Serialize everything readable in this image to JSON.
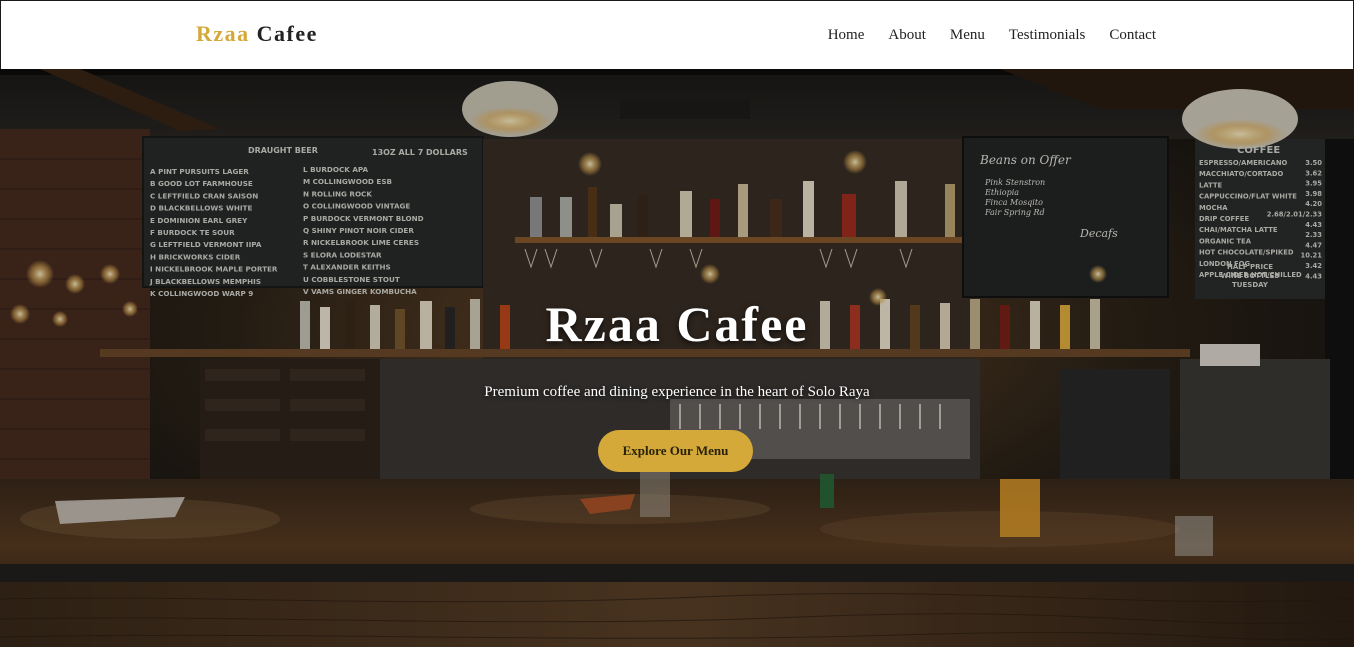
{
  "brand": {
    "name_accent": "Rzaa",
    "name_rest": "Cafee",
    "accent_color": "#d4a93a"
  },
  "nav": {
    "items": [
      "Home",
      "About",
      "Menu",
      "Testimonials",
      "Contact"
    ]
  },
  "hero": {
    "title": "Rzaa Cafee",
    "subtitle": "Premium coffee and dining experience in the heart of Solo Raya",
    "cta_label": "Explore Our Menu",
    "background": "photo of a dimly lit bar with bottle shelves and chalkboard menus"
  },
  "boards": {
    "left_heading": "DRAUGHT BEER",
    "left_sizes": "13OZ   ALL 7 DOLLARS",
    "left_col1": [
      "A PINT PURSUITS LAGER",
      "B GOOD LOT  FARMHOUSE",
      "C LEFTFIELD CRAN SAISON",
      "D BLACKBELLOWS WHITE",
      "E DOMINION EARL GREY",
      "F BURDOCK TE  SOUR",
      "G LEFTFIELD VERMONT IIPA",
      "H BRICKWORKS  CIDER",
      "I NICKELBROOK MAPLE PORTER",
      "J BLACKBELLOWS MEMPHIS",
      "K COLLINGWOOD WARP 9"
    ],
    "left_col2": [
      "L BURDOCK  APA",
      "M COLLINGWOOD ESB",
      "N ROLLING ROCK",
      "O COLLINGWOOD VINTAGE",
      "P BURDOCK VERMONT BLOND",
      "Q SHINY PINOT NOIR CIDER",
      "R NICKELBROOK LIME CERES",
      "S ELORA LODESTAR",
      "T ALEXANDER KEITHS",
      "U COBBLESTONE STOUT",
      "V VAMS GINGER KOMBUCHA"
    ],
    "middle_heading": "Beans on Offer",
    "middle_lines": [
      "Pink Stenstron",
      "Ethiopia",
      "Finca Mosqito",
      "Fair Spring Rd"
    ],
    "middle_heading_2": "Decafs",
    "right_heading": "COFFEE",
    "right_items": [
      "ESPRESSO/AMERICANO",
      "MACCHIATO/CORTADO",
      "LATTE",
      "CAPPUCCINO/FLAT WHITE",
      "MOCHA",
      "DRIP COFFEE",
      "CHAI/MATCHA LATTE",
      "ORGANIC TEA",
      "HOT CHOCOLATE/SPIKED",
      "LONDON FOG",
      "APPLE CIDER HOT/CHILLED"
    ],
    "right_prices": [
      "3.50",
      "3.62",
      "3.95",
      "3.98",
      "4.20",
      "2.68/2.01/2.33",
      "4.43",
      "2.33",
      "4.47",
      "10.21",
      "3.42",
      "4.43"
    ],
    "right_footer": [
      "HALF PRICE",
      "WINE BOTTLES",
      "TUESDAY"
    ]
  }
}
